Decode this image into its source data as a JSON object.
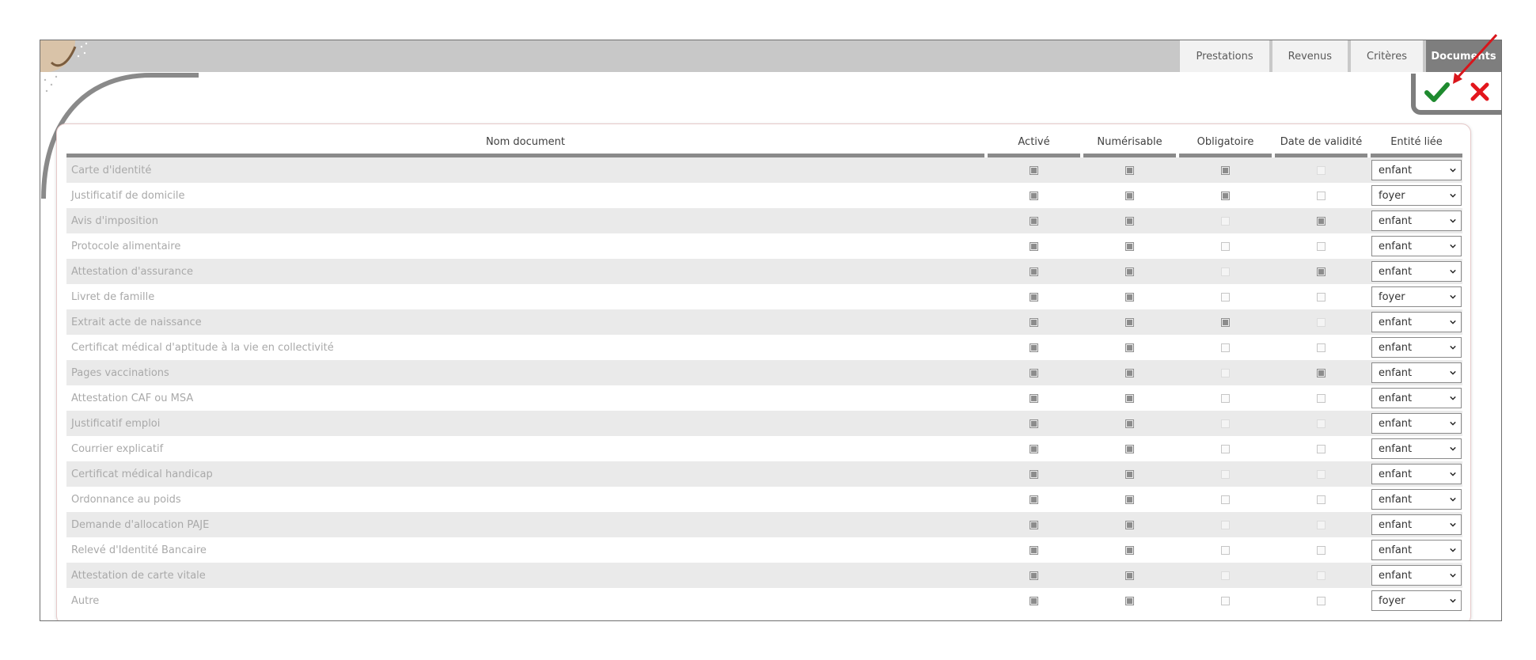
{
  "tabs": [
    {
      "label": "Prestations",
      "active": false
    },
    {
      "label": "Revenus",
      "active": false
    },
    {
      "label": "Critères",
      "active": false
    },
    {
      "label": "Documents",
      "active": true
    }
  ],
  "actions": {
    "confirm": "confirm-check-icon",
    "cancel": "cancel-x-icon"
  },
  "colors": {
    "confirm": "#1e8a2e",
    "cancel": "#e3161c",
    "arrow": "#d9151b",
    "active_tab": "#7e7e7e"
  },
  "columns": {
    "name": "Nom document",
    "active": "Activé",
    "scannable": "Numérisable",
    "mandatory": "Obligatoire",
    "validity": "Date de validité",
    "entity": "Entité liée"
  },
  "rows": [
    {
      "name": "Carte d'identité",
      "active": "checked",
      "scannable": "checked",
      "mandatory": "checked",
      "validity": "disabled",
      "entity": "enfant"
    },
    {
      "name": "Justificatif de domicile",
      "active": "checked",
      "scannable": "checked",
      "mandatory": "checked",
      "validity": "unchecked",
      "entity": "foyer"
    },
    {
      "name": "Avis d'imposition",
      "active": "checked",
      "scannable": "checked",
      "mandatory": "disabled",
      "validity": "checked",
      "entity": "enfant"
    },
    {
      "name": "Protocole alimentaire",
      "active": "checked",
      "scannable": "checked",
      "mandatory": "unchecked",
      "validity": "unchecked",
      "entity": "enfant"
    },
    {
      "name": "Attestation d'assurance",
      "active": "checked",
      "scannable": "checked",
      "mandatory": "disabled",
      "validity": "checked",
      "entity": "enfant"
    },
    {
      "name": "Livret de famille",
      "active": "checked",
      "scannable": "checked",
      "mandatory": "unchecked",
      "validity": "unchecked",
      "entity": "foyer"
    },
    {
      "name": "Extrait acte de naissance",
      "active": "checked",
      "scannable": "checked",
      "mandatory": "checked",
      "validity": "disabled",
      "entity": "enfant"
    },
    {
      "name": "Certificat médical d'aptitude à la vie en collectivité",
      "active": "checked",
      "scannable": "checked",
      "mandatory": "unchecked",
      "validity": "unchecked",
      "entity": "enfant"
    },
    {
      "name": "Pages vaccinations",
      "active": "checked",
      "scannable": "checked",
      "mandatory": "disabled",
      "validity": "checked",
      "entity": "enfant"
    },
    {
      "name": "Attestation CAF ou MSA",
      "active": "checked",
      "scannable": "checked",
      "mandatory": "unchecked",
      "validity": "unchecked",
      "entity": "enfant"
    },
    {
      "name": "Justificatif emploi",
      "active": "checked",
      "scannable": "checked",
      "mandatory": "disabled",
      "validity": "disabled",
      "entity": "enfant"
    },
    {
      "name": "Courrier explicatif",
      "active": "checked",
      "scannable": "checked",
      "mandatory": "unchecked",
      "validity": "unchecked",
      "entity": "enfant"
    },
    {
      "name": "Certificat médical handicap",
      "active": "checked",
      "scannable": "checked",
      "mandatory": "disabled",
      "validity": "disabled",
      "entity": "enfant"
    },
    {
      "name": "Ordonnance au poids",
      "active": "checked",
      "scannable": "checked",
      "mandatory": "unchecked",
      "validity": "unchecked",
      "entity": "enfant"
    },
    {
      "name": "Demande d'allocation PAJE",
      "active": "checked",
      "scannable": "checked",
      "mandatory": "disabled",
      "validity": "disabled",
      "entity": "enfant"
    },
    {
      "name": "Relevé d'Identité Bancaire",
      "active": "checked",
      "scannable": "checked",
      "mandatory": "unchecked",
      "validity": "unchecked",
      "entity": "enfant"
    },
    {
      "name": "Attestation de carte vitale",
      "active": "checked",
      "scannable": "checked",
      "mandatory": "disabled",
      "validity": "disabled",
      "entity": "enfant"
    },
    {
      "name": "Autre",
      "active": "checked",
      "scannable": "checked",
      "mandatory": "unchecked",
      "validity": "unchecked",
      "entity": "foyer"
    }
  ]
}
